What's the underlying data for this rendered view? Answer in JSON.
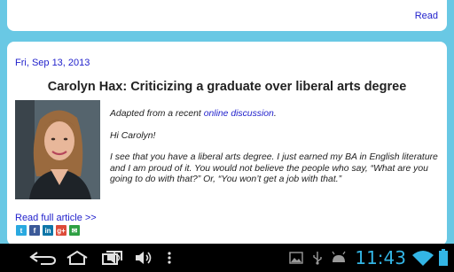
{
  "previous_card": {
    "read_label": "Read"
  },
  "article": {
    "date": "Fri, Sep 13, 2013",
    "headline": "Carolyn Hax: Criticizing a graduate over liberal arts degree",
    "intro_prefix": "Adapted from a recent ",
    "intro_link": "online discussion",
    "intro_suffix": ".",
    "greeting": "Hi Carolyn!",
    "body": "I see that you have a liberal arts degree. I just earned my BA in English literature and I am proud of it. You would not believe the people who say, “What are you going to do with that?” Or, “You won’t get a job with that.”",
    "read_full_label": "Read full article >>"
  },
  "share": [
    {
      "icon": "twitter-icon",
      "glyph": "t",
      "color": "#2aa9e0"
    },
    {
      "icon": "facebook-icon",
      "glyph": "f",
      "color": "#3b5998"
    },
    {
      "icon": "linkedin-icon",
      "glyph": "in",
      "color": "#0e76a8"
    },
    {
      "icon": "google-plus-icon",
      "glyph": "g+",
      "color": "#dd4b39"
    },
    {
      "icon": "email-icon",
      "glyph": "✉",
      "color": "#2ea043"
    }
  ],
  "system_bar": {
    "clock": "11:43",
    "accent": "#33b5e5"
  }
}
